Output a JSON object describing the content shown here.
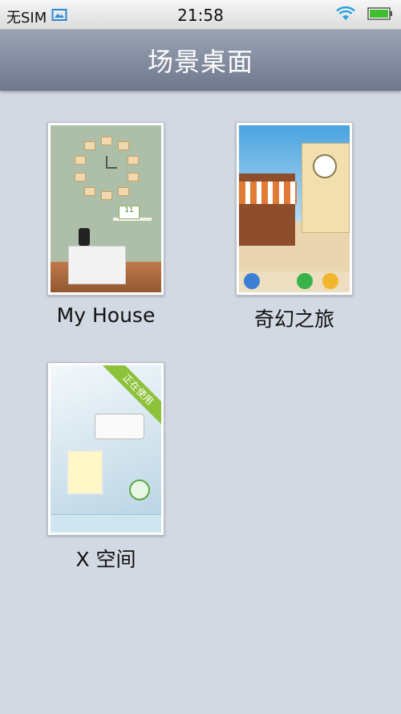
{
  "status_bar": {
    "carrier": "无SIM",
    "time": "21:58",
    "icons": [
      "image-notification-icon",
      "wifi-icon",
      "battery-icon"
    ]
  },
  "header": {
    "title": "场景桌面"
  },
  "scenes": [
    {
      "label": "My House"
    },
    {
      "label": "奇幻之旅"
    },
    {
      "label": "X 空间",
      "badge": "正在使用"
    }
  ],
  "thumb_texts": {
    "calendar_day": "11"
  },
  "colors": {
    "background": "#d3d9e3",
    "header_top": "#9aa3b4",
    "header_bottom": "#6e788c",
    "badge_green": "#8cc13a",
    "battery_green": "#3fbf2f"
  }
}
